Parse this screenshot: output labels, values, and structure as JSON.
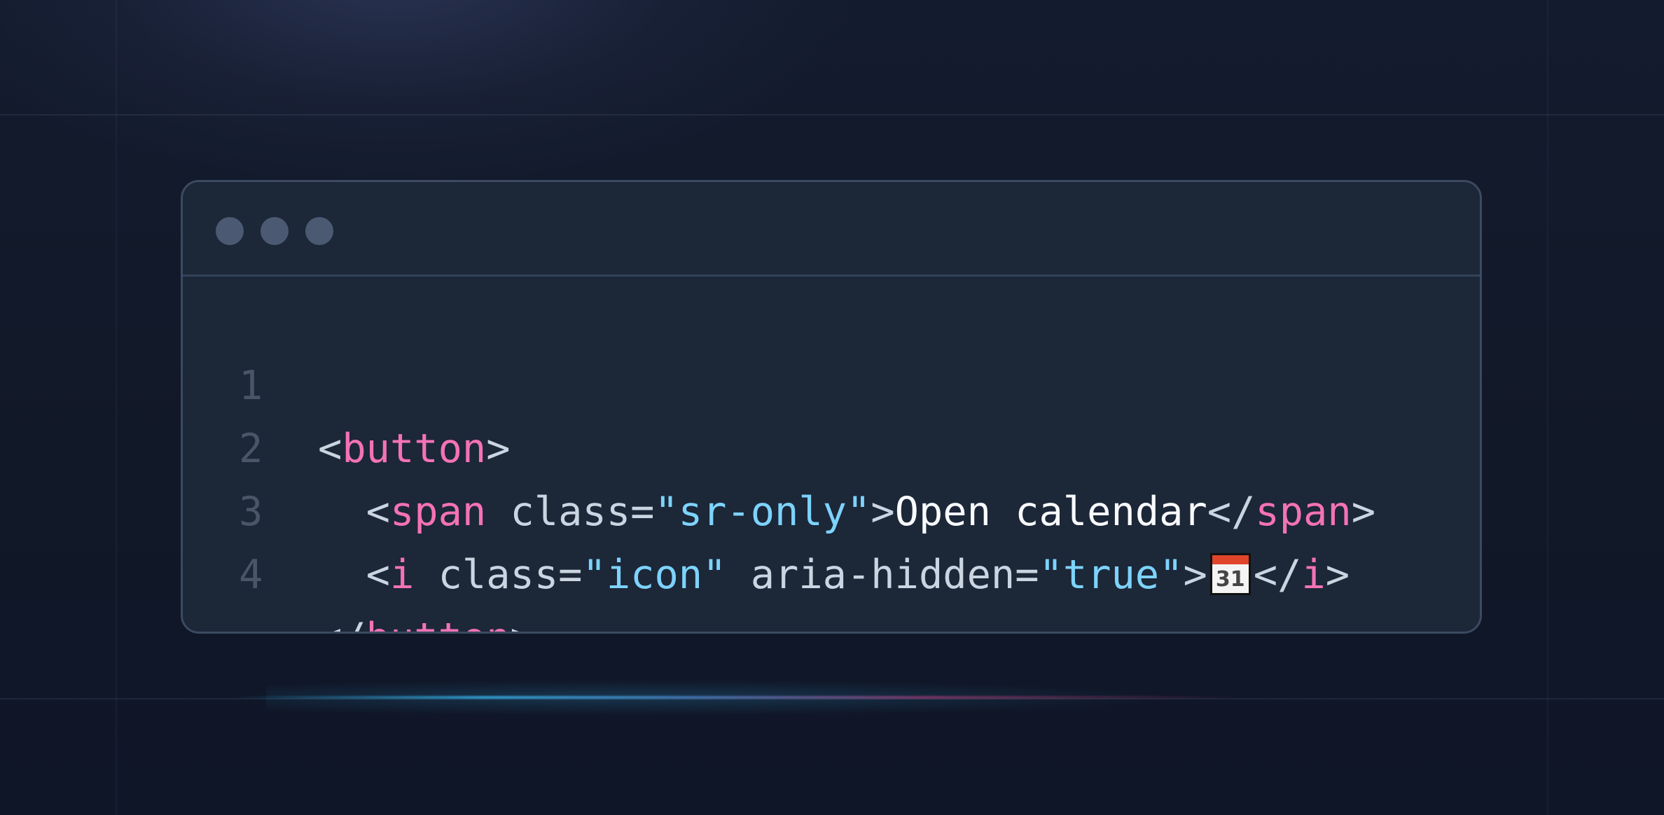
{
  "window": {
    "controls": [
      "window-dot-1",
      "window-dot-2",
      "window-dot-3"
    ]
  },
  "code": {
    "lines": [
      {
        "number": "1",
        "tokens": [
          {
            "kind": "punct",
            "text": "<"
          },
          {
            "kind": "tag",
            "text": "button"
          },
          {
            "kind": "punct",
            "text": ">"
          }
        ]
      },
      {
        "number": "2",
        "tokens": [
          {
            "kind": "punct",
            "text": "  <"
          },
          {
            "kind": "tag",
            "text": "span"
          },
          {
            "kind": "attr",
            "text": " class="
          },
          {
            "kind": "string",
            "text": "\"sr-only\""
          },
          {
            "kind": "punct",
            "text": ">"
          },
          {
            "kind": "text",
            "text": "Open calendar"
          },
          {
            "kind": "punct",
            "text": "</"
          },
          {
            "kind": "tag",
            "text": "span"
          },
          {
            "kind": "punct",
            "text": ">"
          }
        ]
      },
      {
        "number": "3",
        "tokens": [
          {
            "kind": "punct",
            "text": "  <"
          },
          {
            "kind": "tag",
            "text": "i"
          },
          {
            "kind": "attr",
            "text": " class="
          },
          {
            "kind": "string",
            "text": "\"icon\""
          },
          {
            "kind": "attr",
            "text": " aria-hidden="
          },
          {
            "kind": "string",
            "text": "\"true\""
          },
          {
            "kind": "punct",
            "text": ">"
          },
          {
            "kind": "emoji",
            "text": "31",
            "icon": "calendar-icon"
          },
          {
            "kind": "punct",
            "text": "</"
          },
          {
            "kind": "tag",
            "text": "i"
          },
          {
            "kind": "punct",
            "text": ">"
          }
        ]
      },
      {
        "number": "4",
        "tokens": [
          {
            "kind": "punct",
            "text": "</"
          },
          {
            "kind": "tag",
            "text": "button"
          },
          {
            "kind": "punct",
            "text": ">"
          }
        ]
      }
    ]
  },
  "colors": {
    "background": "#111827",
    "window": "#1c2738",
    "border": "#3b4a60",
    "tag": "#f472b6",
    "string": "#7dd3fc",
    "attribute": "#cbd5e1",
    "text": "#f8fafc",
    "line_number": "#4a5568",
    "accent_line_left": "#38bdf8",
    "accent_line_right": "#ec4899"
  }
}
